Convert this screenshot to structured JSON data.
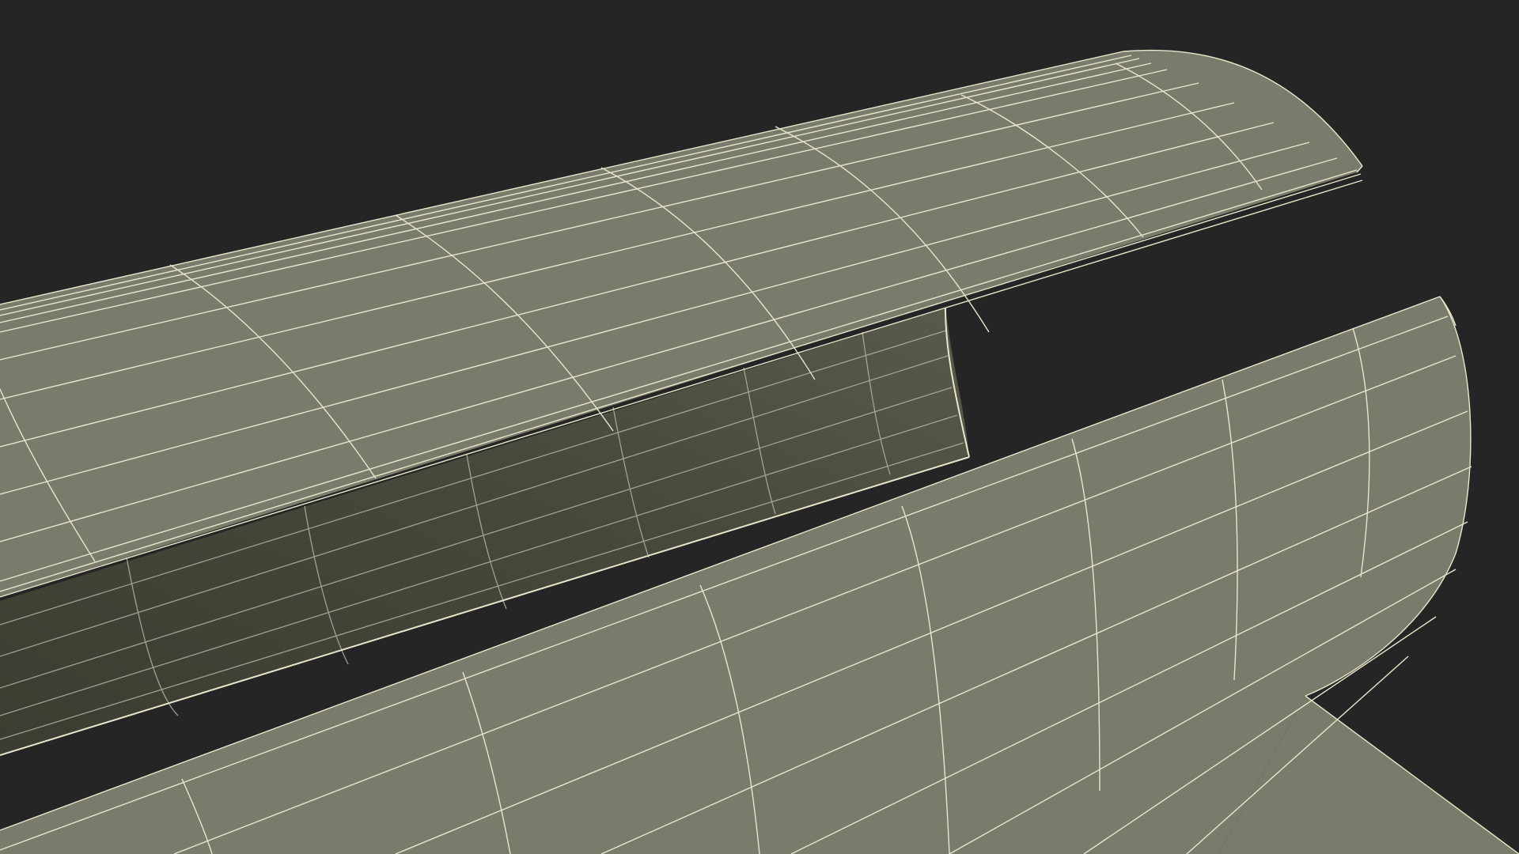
{
  "scene": {
    "kind": "3d-wireframe-render",
    "object": "split-cylindrical-shell",
    "colors": {
      "background": "#252525",
      "surface": "#7b7b6b",
      "surface_inner": "#4c4c40",
      "surface_inner_dark": "#3e3e34",
      "wire": "#e8e6cc"
    }
  }
}
